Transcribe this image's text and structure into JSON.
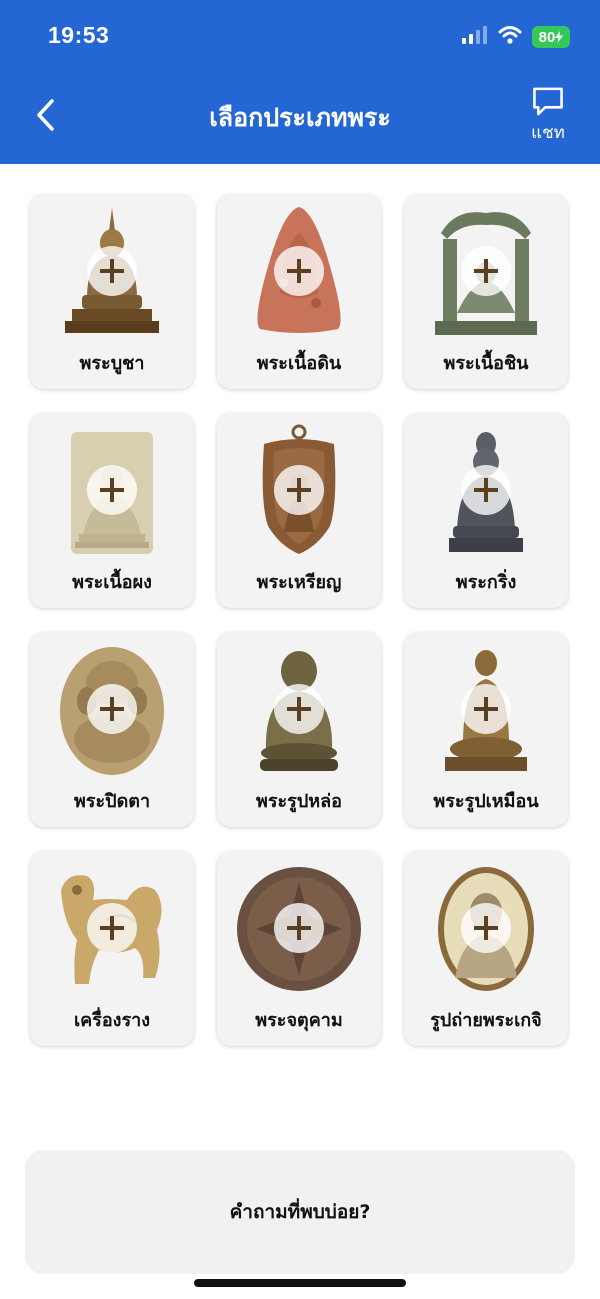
{
  "status_bar": {
    "time": "19:53",
    "battery": "80"
  },
  "header": {
    "title": "เลือกประเภทพระ",
    "chat_label": "แชท"
  },
  "categories": [
    {
      "label": "พระบูชา"
    },
    {
      "label": "พระเนื้อดิน"
    },
    {
      "label": "พระเนื้อชิน"
    },
    {
      "label": "พระเนื้อผง"
    },
    {
      "label": "พระเหรียญ"
    },
    {
      "label": "พระกริ่ง"
    },
    {
      "label": "พระปิดตา"
    },
    {
      "label": "พระรูปหล่อ"
    },
    {
      "label": "พระรูปเหมือน"
    },
    {
      "label": "เครื่องราง"
    },
    {
      "label": "พระจตุคาม"
    },
    {
      "label": "รูปถ่ายพระเกจิ"
    }
  ],
  "faq": {
    "label": "คำถามที่พบบ่อย?"
  },
  "colors": {
    "header": "#2467d4",
    "battery": "#34c759",
    "card": "#f3f3f3"
  }
}
